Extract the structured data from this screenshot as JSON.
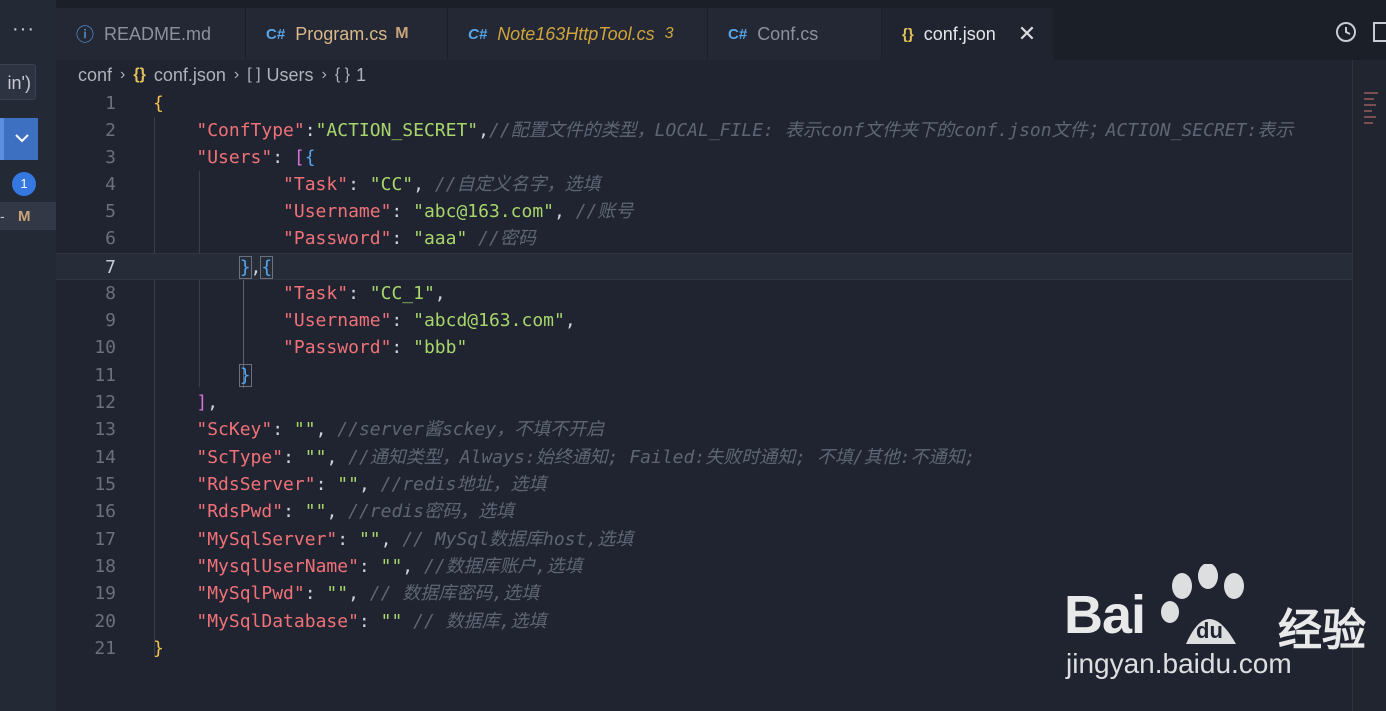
{
  "sidebar": {
    "more_label": "···",
    "input_value": "in')",
    "badge_count": "1",
    "modified_marker": "M",
    "dash": "-"
  },
  "tabs": [
    {
      "icon": "ⓘ",
      "label": "README.md"
    },
    {
      "icon": "C#",
      "label": "Program.cs",
      "badge": "M"
    },
    {
      "icon": "C#",
      "label": "Note163HttpTool.cs",
      "badge": "3"
    },
    {
      "icon": "C#",
      "label": "Conf.cs"
    },
    {
      "icon": "{}",
      "label": "conf.json",
      "close": "✕"
    }
  ],
  "breadcrumb": {
    "folder": "conf",
    "file": "conf.json",
    "array_icon": "[ ]",
    "array": "Users",
    "object_icon": "{ }",
    "object": "1"
  },
  "editor": {
    "current_line": 7,
    "lines": [
      {
        "n": "1"
      },
      {
        "n": "2"
      },
      {
        "n": "3"
      },
      {
        "n": "4"
      },
      {
        "n": "5"
      },
      {
        "n": "6"
      },
      {
        "n": "7"
      },
      {
        "n": "8"
      },
      {
        "n": "9"
      },
      {
        "n": "10"
      },
      {
        "n": "11"
      },
      {
        "n": "12"
      },
      {
        "n": "13"
      },
      {
        "n": "14"
      },
      {
        "n": "15"
      },
      {
        "n": "16"
      },
      {
        "n": "17"
      },
      {
        "n": "18"
      },
      {
        "n": "19"
      },
      {
        "n": "20"
      },
      {
        "n": "21"
      }
    ],
    "code": {
      "l1_open": "{",
      "l2_key": "\"ConfType\"",
      "l2_val": "\"ACTION_SECRET\"",
      "l2_comment": "//配置文件的类型，LOCAL_FILE: 表示conf文件夹下的conf.json文件；ACTION_SECRET:表示",
      "l3_key": "\"Users\"",
      "l4_key": "\"Task\"",
      "l4_val": "\"CC\"",
      "l4_comment": "//自定义名字，选填",
      "l5_key": "\"Username\"",
      "l5_val": "\"abc@163.com\"",
      "l5_comment": "//账号",
      "l6_key": "\"Password\"",
      "l6_val": "\"aaa\"",
      "l6_comment": "//密码",
      "l8_key": "\"Task\"",
      "l8_val": "\"CC_1\"",
      "l9_key": "\"Username\"",
      "l9_val": "\"abcd@163.com\"",
      "l10_key": "\"Password\"",
      "l10_val": "\"bbb\"",
      "l13_key": "\"ScKey\"",
      "l13_val": "\"\"",
      "l13_comment": "//server酱sckey，不填不开启",
      "l14_key": "\"ScType\"",
      "l14_val": "\"\"",
      "l14_comment": "//通知类型，Always:始终通知; Failed:失败时通知; 不填/其他:不通知;",
      "l15_key": "\"RdsServer\"",
      "l15_val": "\"\"",
      "l15_comment": "//redis地址，选填",
      "l16_key": "\"RdsPwd\"",
      "l16_val": "\"\"",
      "l16_comment": "//redis密码，选填",
      "l17_key": "\"MySqlServer\"",
      "l17_val": "\"\"",
      "l17_comment": "// MySql数据库host,选填",
      "l18_key": "\"MysqlUserName\"",
      "l18_val": "\"\"",
      "l18_comment": "//数据库账户,选填",
      "l19_key": "\"MySqlPwd\"",
      "l19_val": "\"\"",
      "l19_comment": "// 数据库密码,选填",
      "l20_key": "\"MySqlDatabase\"",
      "l20_val": "\"\"",
      "l20_comment": "// 数据库,选填",
      "l21_close": "}"
    }
  },
  "watermark": {
    "brand": "Bai",
    "brand_suffix": "经验",
    "url": "jingyan.baidu.com"
  },
  "colors": {
    "background": "#1f2430",
    "key": "#f07178",
    "string": "#a8d66b",
    "comment": "#5f6673",
    "bracket_outer": "#f2c14e",
    "bracket_mid": "#d770d7",
    "bracket_inner": "#55a8f0"
  }
}
